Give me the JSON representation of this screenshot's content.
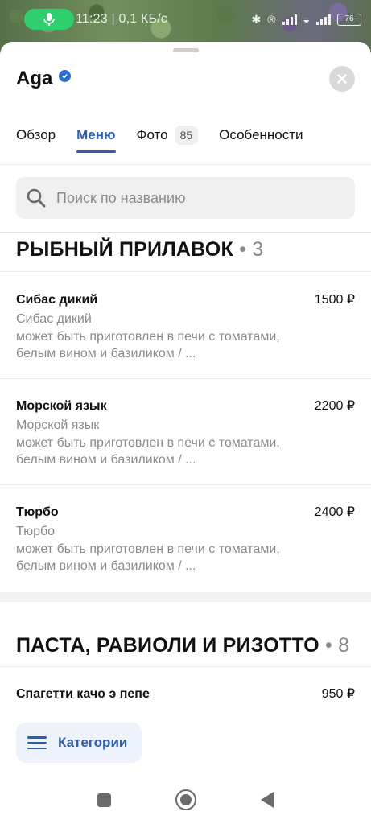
{
  "status_bar": {
    "time_speed": "11:23 | 0,1 КБ/с",
    "battery": "76"
  },
  "header": {
    "title": "Aga"
  },
  "tabs": [
    {
      "label": "Обзор"
    },
    {
      "label": "Меню",
      "active": true
    },
    {
      "label": "Фото",
      "badge": "85"
    },
    {
      "label": "Особенности"
    }
  ],
  "search": {
    "placeholder": "Поиск по названию",
    "value": ""
  },
  "sections": [
    {
      "title": "РЫБНЫЙ ПРИЛАВОК",
      "count": "3",
      "items": [
        {
          "name": "Сибас дикий",
          "price": "1500 ₽",
          "subtitle": "Сибас дикий",
          "description": "может быть приготовлен в печи с томатами, белым вином и базиликом / ..."
        },
        {
          "name": "Морской язык",
          "price": "2200 ₽",
          "subtitle": "Морской язык",
          "description": "может быть приготовлен в печи с томатами, белым вином и базиликом / ..."
        },
        {
          "name": "Тюрбо",
          "price": "2400 ₽",
          "subtitle": "Тюрбо",
          "description": "может быть приготовлен в печи с томатами, белым вином и базиликом / ..."
        }
      ]
    },
    {
      "title": "ПАСТА, РАВИОЛИ И РИЗОТТО",
      "count": "8",
      "items": [
        {
          "name": "Спагетти качо э пепе",
          "price": "950 ₽"
        }
      ]
    }
  ],
  "categories_button": {
    "label": "Категории"
  },
  "colors": {
    "accent": "#2f5fa8",
    "verified": "#2b6fd6",
    "mic_pill": "#2fcf6f"
  }
}
